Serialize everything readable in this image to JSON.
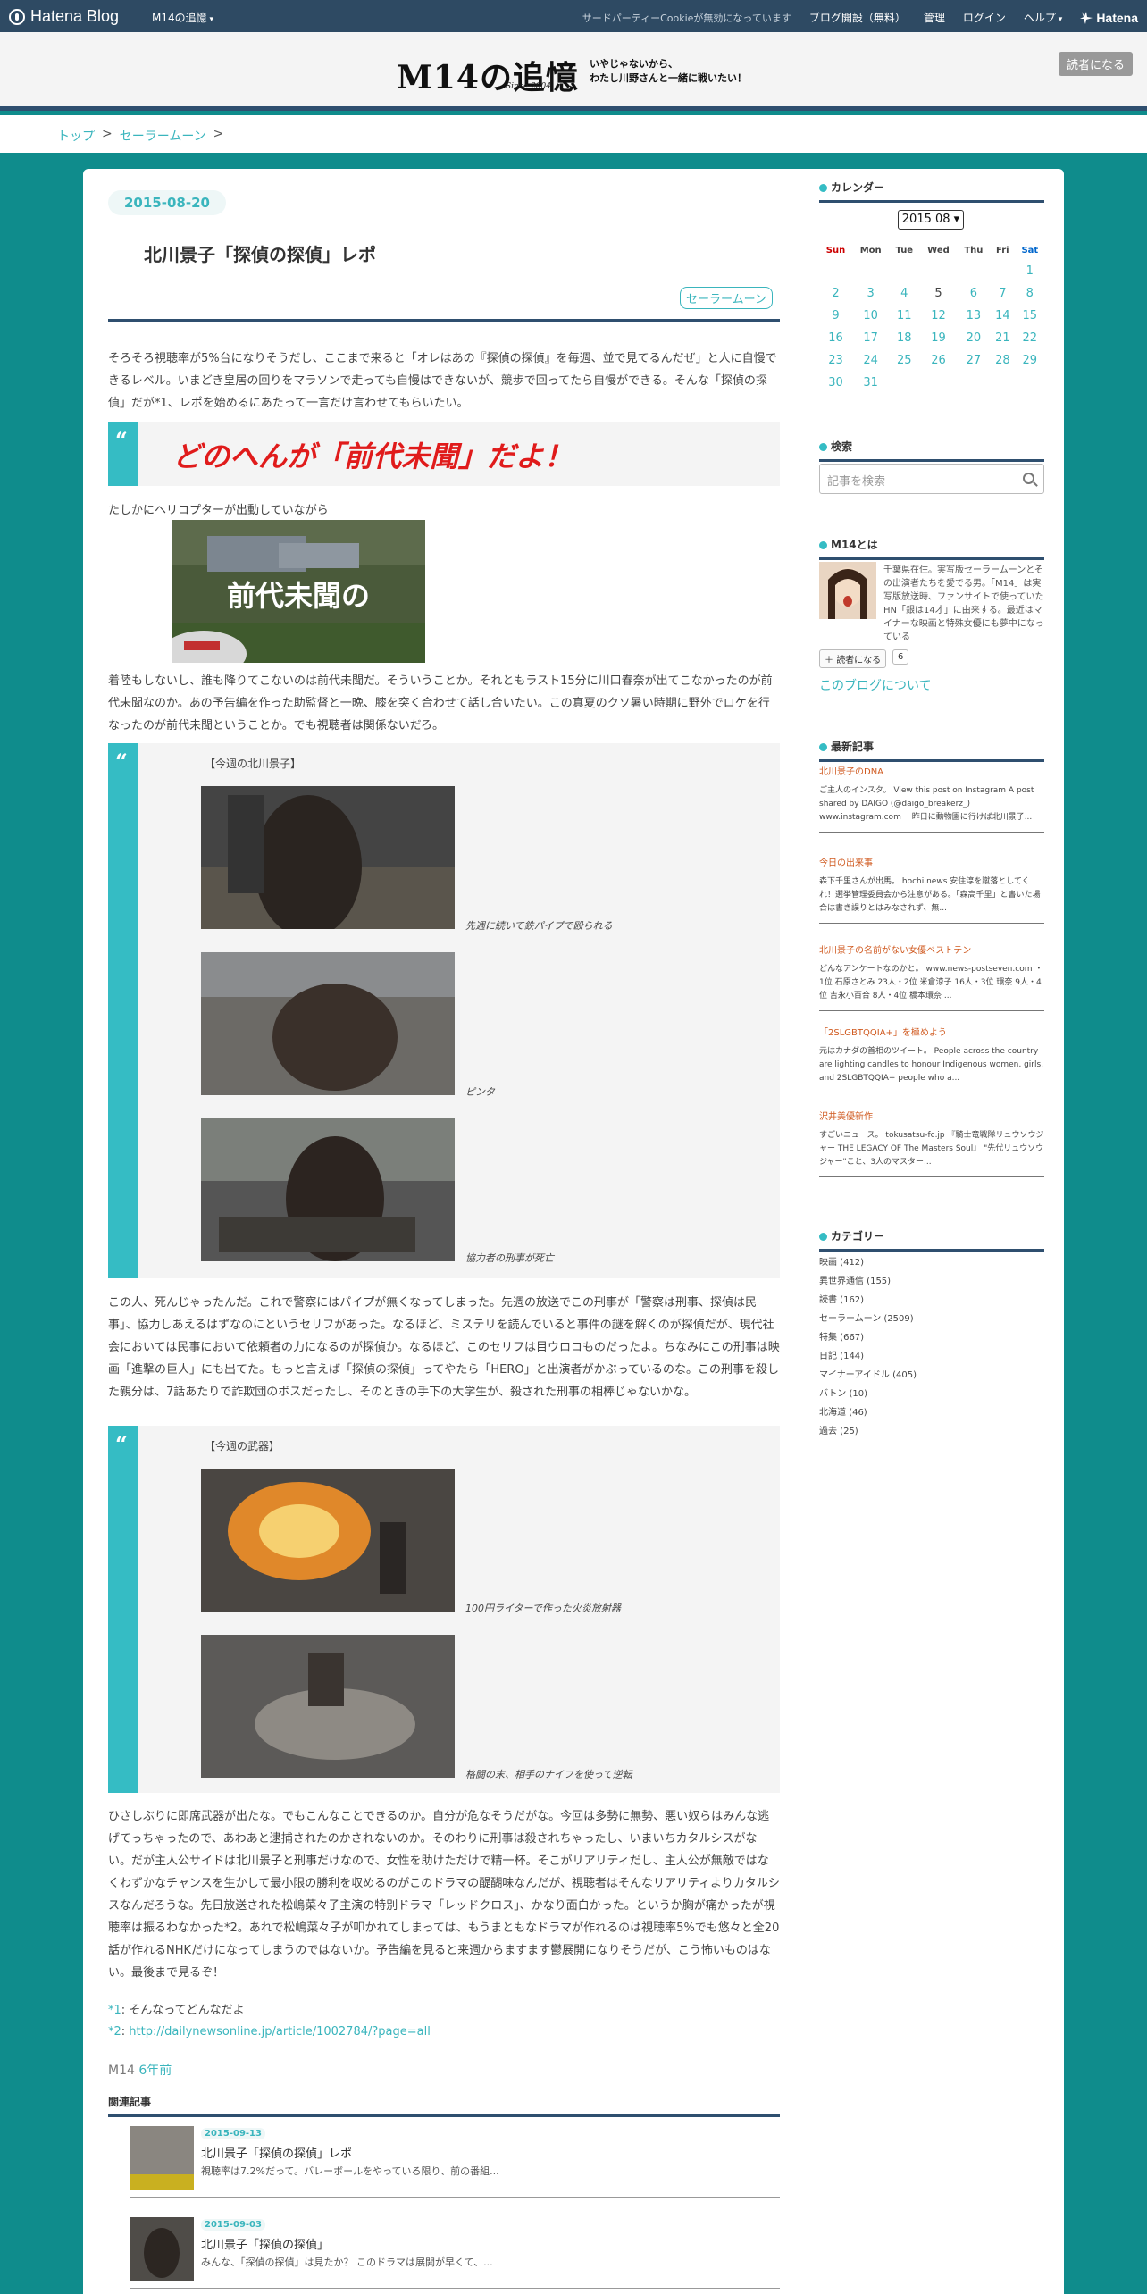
{
  "global_bar": {
    "logo": "Hatena Blog",
    "blog_menu": "M14の追憶",
    "cookie_notice": "サードパーティーCookieが無効になっています",
    "links": [
      "ブログ開設（無料）",
      "管理",
      "ログイン",
      "ヘルプ"
    ],
    "brand": "Hatena"
  },
  "header": {
    "title": "M14の追憶",
    "since": "Since 2004",
    "description_line1": "いやじゃないから、",
    "description_line2": "わたし川野さんと一緒に戦いたい！",
    "subscribe_label": "読者になる"
  },
  "breadcrumb": {
    "items": [
      "トップ",
      "セーラームーン"
    ],
    "separator": ">"
  },
  "entry": {
    "date": "2015-08-20",
    "title": "北川景子「探偵の探偵」レポ",
    "category": "セーラームーン",
    "intro": "そろそろ視聴率が5%台になりそうだし、ここまで来ると「オレはあの『探偵の探偵』を毎週、並で見てるんだぜ」と人に自慢できるレベル。いまどき皇居の回りをマラソンで走っても自慢はできないが、競歩で回ってたら自慢ができる。そんな「探偵の探偵」だが*1、レポを始めるにあたって一言だけ言わせてもらいたい。",
    "quote_headline": "どのへんが「前代未聞」だよ！",
    "line_heli": "たしかにヘリコプターが出動していながら",
    "banner_text": "前代未聞の",
    "para2": "着陸もしないし、誰も降りてこないのは前代未聞だ。そういうことか。それともラスト15分に川口春奈が出てこなかったのが前代未聞なのか。あの予告編を作った助監督と一晩、膝を突く合わせて話し合いたい。この真夏のクソ暑い時期に野外でロケを行なったのが前代未聞ということか。でも視聴者は関係ないだろ。",
    "quote2_title": "【今週の北川景子】",
    "captions1": [
      "先週に続いて鉄パイプで殴られる",
      "ピンタ",
      "協力者の刑事が死亡"
    ],
    "para3": "この人、死んじゃったんだ。これで警察にはパイプが無くなってしまった。先週の放送でこの刑事が「警察は刑事、探偵は民事」、協力しあえるはずなのにというセリフがあった。なるほど、ミステリを読んでいると事件の謎を解くのが探偵だが、現代社会においては民事において依頼者の力になるのが探偵か。なるほど、このセリフは目ウロコものだったよ。ちなみにこの刑事は映画「進撃の巨人」にも出てた。もっと言えば「探偵の探偵」ってやたら「HERO」と出演者がかぶっているのな。この刑事を殺した親分は、7話あたりで詐欺団のボスだったし、そのときの手下の大学生が、殺された刑事の相棒じゃないかな。",
    "quote3_title": "【今週の武器】",
    "captions2": [
      "100円ライターで作った火炎放射器",
      "格闘の末、相手のナイフを使って逆転"
    ],
    "para4": "ひさしぶりに即席武器が出たな。でもこんなことできるのか。自分が危なそうだがな。今回は多勢に無勢、悪い奴らはみんな逃げてっちゃったので、あわあと逮捕されたのかされないのか。そのわりに刑事は殺されちゃったし、いまいちカタルシスがない。だが主人公サイドは北川景子と刑事だけなので、女性を助けただけで精一杯。そこがリアリティだし、主人公が無敵ではなくわずかなチャンスを生かして最小限の勝利を収めるのがこのドラマの醍醐味なんだが、視聴者はそんなリアリティよりカタルシスなんだろうな。先日放送された松嶋菜々子主演の特別ドラマ「レッドクロス」、かなり面白かった。というか胸が痛かったが視聴率は振るわなかった*2。あれで松嶋菜々子が叩かれてしまっては、もうまともなドラマが作れるのは視聴率5%でも悠々と全20話が作れるNHKだけになってしまうのではないか。予告編を見ると来週からますます鬱展開になりそうだが、こう怖いものはない。最後まで見るぞ！",
    "footnote1_mark": "*1",
    "footnote1": "そんなってどんなだよ",
    "footnote2_mark": "*2",
    "footnote2": "http://dailynewsonline.jp/article/1002784/?page=all",
    "author": "M14",
    "ago": "6年前"
  },
  "related": {
    "heading": "関連記事",
    "items": [
      {
        "date": "2015-09-13",
        "title": "北川景子「探偵の探偵」レポ",
        "excerpt": "視聴率は7.2%だって。バレーボールをやっている限り、前の番組..."
      },
      {
        "date": "2015-09-03",
        "title": "北川景子「探偵の探偵」",
        "excerpt": "みんな、「探偵の探偵」は見たか？ このドラマは展開が早くて、..."
      }
    ]
  },
  "sidebar": {
    "calendar": {
      "heading": "カレンダー",
      "month": "2015 08",
      "weekdays": [
        "Sun",
        "Mon",
        "Tue",
        "Wed",
        "Thu",
        "Fri",
        "Sat"
      ],
      "weeks": [
        [
          "",
          "",
          "",
          "",
          "",
          "",
          "1"
        ],
        [
          "2",
          "3",
          "4",
          "5",
          "6",
          "7",
          "8"
        ],
        [
          "9",
          "10",
          "11",
          "12",
          "13",
          "14",
          "15"
        ],
        [
          "16",
          "17",
          "18",
          "19",
          "20",
          "21",
          "22"
        ],
        [
          "23",
          "24",
          "25",
          "26",
          "27",
          "28",
          "29"
        ],
        [
          "30",
          "31",
          "",
          "",
          "",
          "",
          ""
        ]
      ],
      "unlinked_day": "5"
    },
    "search": {
      "heading": "検索",
      "placeholder": "記事を検索"
    },
    "about": {
      "heading": "M14とは",
      "text": "千葉県在住。実写版セーラームーンとその出演者たちを愛でる男。「M14」は実写版放送時、ファンサイトで使っていたHN「銀は14才」に由来する。最近はマイナーな映画と特殊女優にも夢中になっている",
      "subscribe": "読者になる",
      "count": "6",
      "link": "このブログについて"
    },
    "recent": {
      "heading": "最新記事",
      "items": [
        {
          "title": "北川景子のDNA",
          "excerpt": "ご主人のインスタ。 View this post on Instagram A post shared by DAIGO (@daigo_breakerz_) www.instagram.com 一昨日に動物園に行けば北川景子..."
        },
        {
          "title": "今日の出来事",
          "excerpt": "森下千里さんが出馬。 hochi.news 安住淳を蹴落としてくれ！選挙管理委員会から注意がある。「森高千里」と書いた場合は書き誤りとはみなされず、無..."
        },
        {
          "title": "北川景子の名前がない女優ベストテン",
          "excerpt": "どんなアンケートなのかと。 www.news-postseven.com ・1位 石原さとみ 23人・2位 米倉涼子 16人・3位 環奈 9人・4位 吉永小百合 8人・4位 橋本環奈 ..."
        },
        {
          "title": "「2SLGBTQQIA+」を極めよう",
          "excerpt": "元はカナダの首相のツイート。 People across the country are lighting candles to honour Indigenous women, girls, and 2SLGBTQQIA+ people who a..."
        },
        {
          "title": "沢井美優新作",
          "excerpt": "すごいニュース。 tokusatsu-fc.jp 『騎士竜戦隊リュウソウジャー THE LEGACY OF The Masters Soul』 \"先代リュウソウジャー\"こと、3人のマスター..."
        }
      ]
    },
    "categories": {
      "heading": "カテゴリー",
      "items": [
        "映画 (412)",
        "異世界通信 (155)",
        "読書 (162)",
        "セーラームーン (2509)",
        "特集 (667)",
        "日記 (144)",
        "マイナーアイドル (405)",
        "バトン (10)",
        "北海道 (46)",
        "過去 (25)"
      ]
    }
  }
}
